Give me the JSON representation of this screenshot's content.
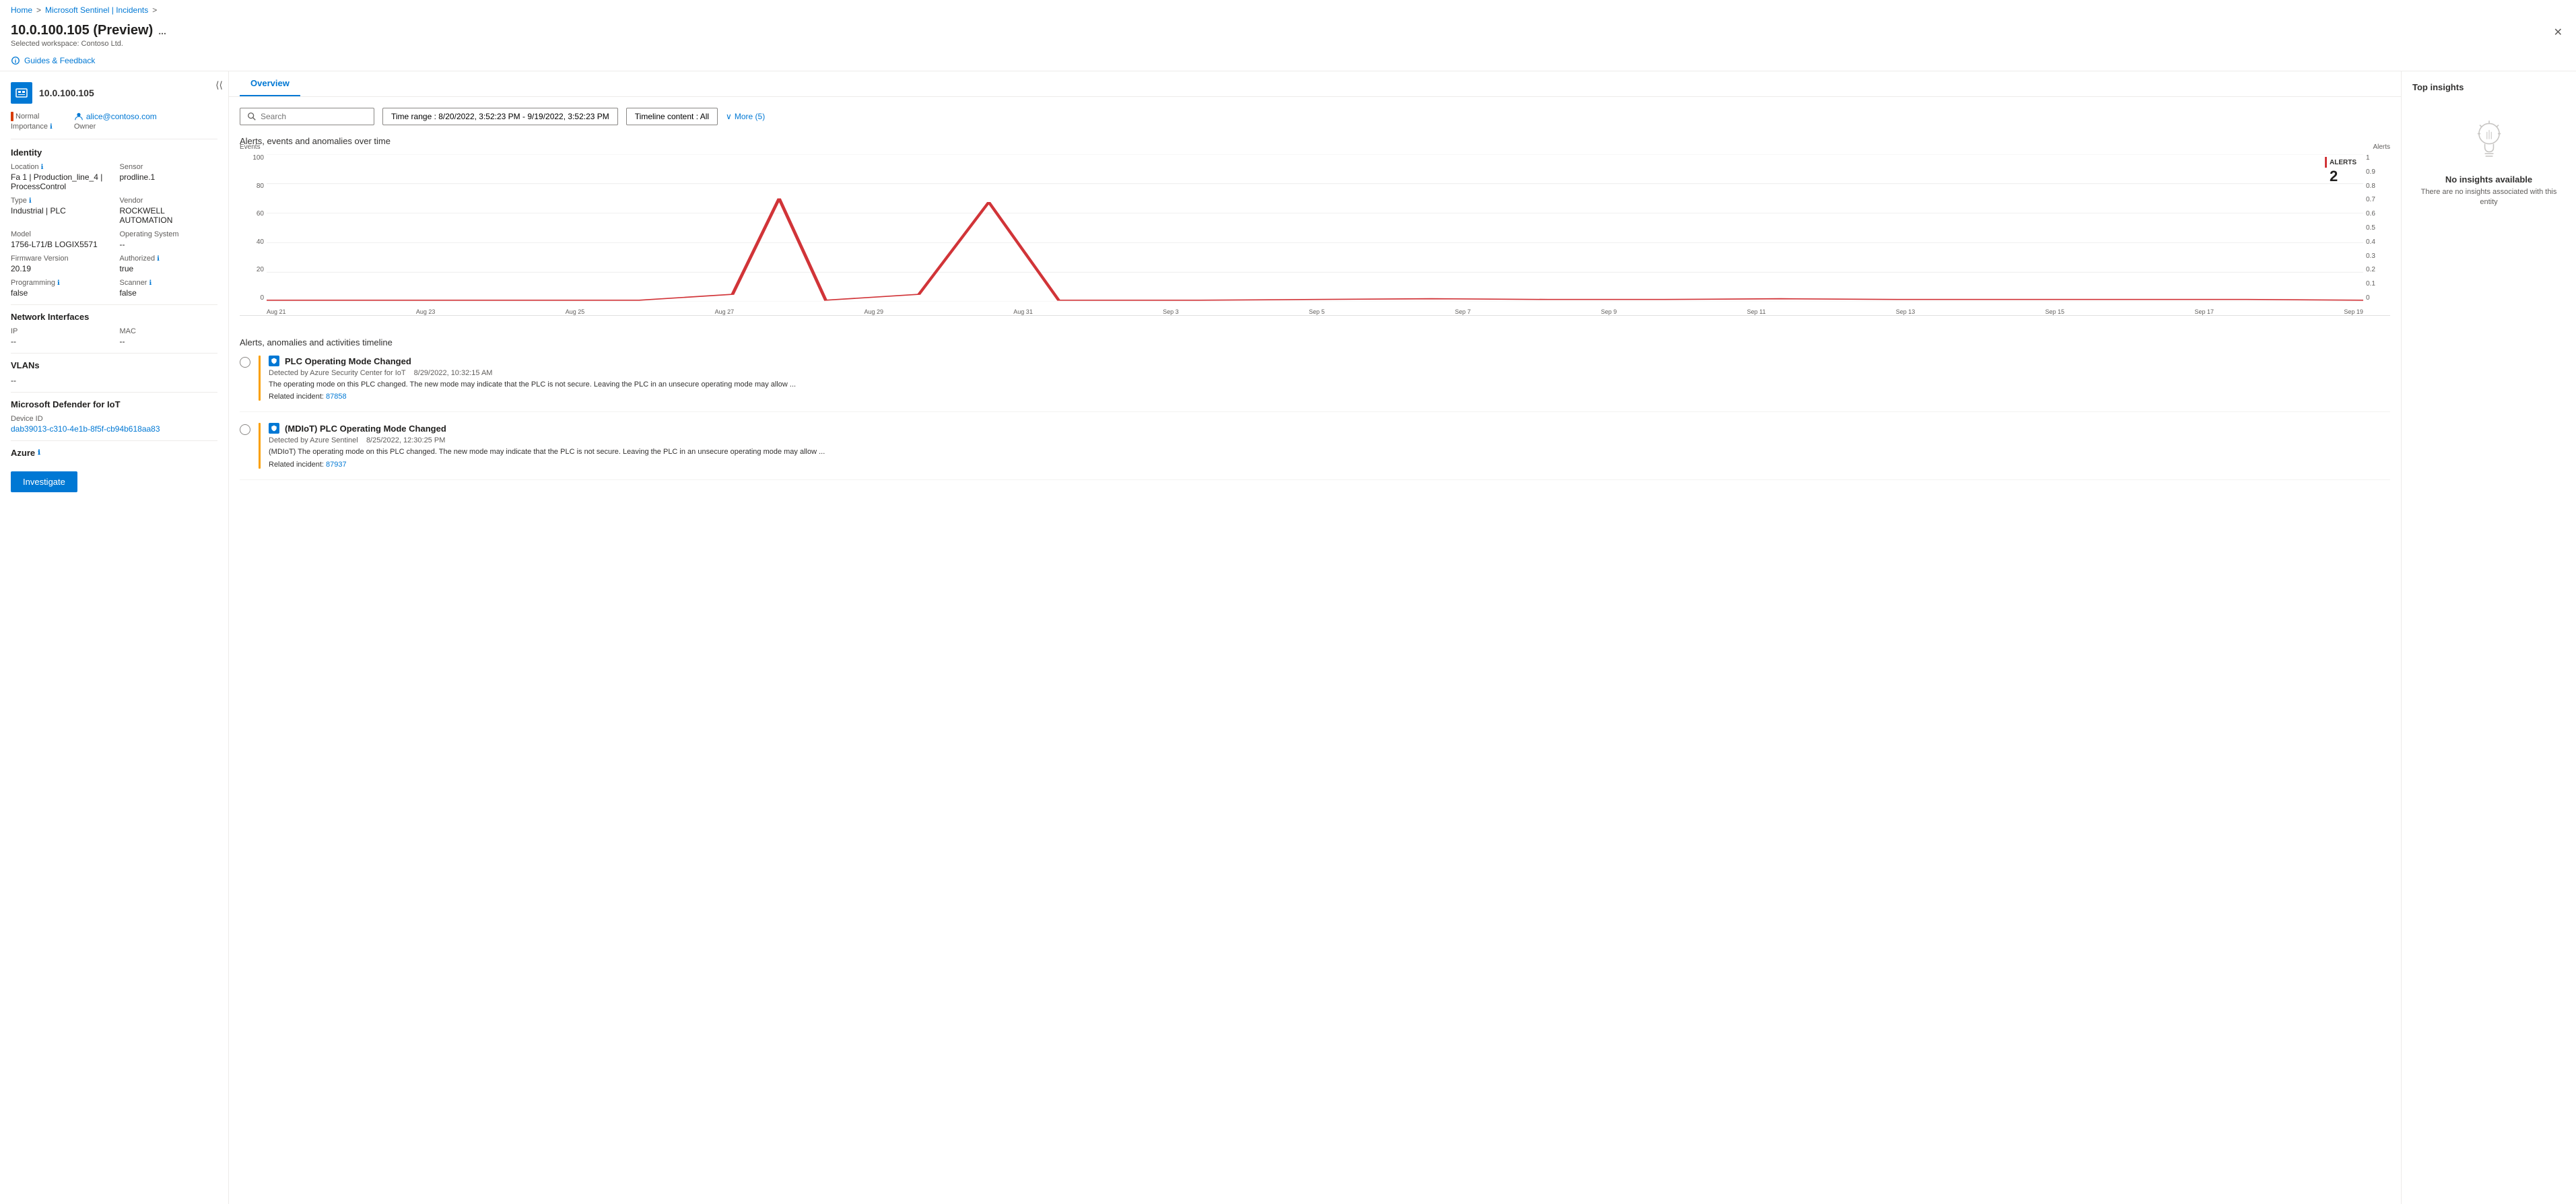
{
  "breadcrumb": {
    "home": "Home",
    "sentinel": "Microsoft Sentinel | Incidents",
    "separator": ">"
  },
  "header": {
    "title": "10.0.100.105 (Preview)",
    "subtitle": "Selected workspace: Contoso Ltd.",
    "more_label": "...",
    "close_label": "✕"
  },
  "guides": {
    "label": "Guides & Feedback"
  },
  "left_panel": {
    "entity_name": "10.0.100.105",
    "importance_label": "Importance",
    "importance_info": "ℹ",
    "status": "Normal",
    "owner_name": "alice@contoso.com",
    "owner_role": "Owner",
    "sections": {
      "identity": {
        "title": "Identity",
        "location_label": "Location",
        "location_info": "ℹ",
        "location_value": "Fa 1 | Production_line_4 | ProcessControl",
        "sensor_label": "Sensor",
        "sensor_value": "prodline.1",
        "type_label": "Type",
        "type_info": "ℹ",
        "type_value": "Industrial | PLC",
        "vendor_label": "Vendor",
        "vendor_value": "ROCKWELL AUTOMATION",
        "model_label": "Model",
        "model_value": "1756-L71/B LOGIX5571",
        "os_label": "Operating System",
        "os_value": "--",
        "firmware_label": "Firmware Version",
        "firmware_info": "",
        "firmware_value": "20.19",
        "authorized_label": "Authorized",
        "authorized_info": "ℹ",
        "authorized_value": "true",
        "programming_label": "Programming",
        "programming_info": "ℹ",
        "programming_value": "false",
        "scanner_label": "Scanner",
        "scanner_info": "ℹ",
        "scanner_value": "false"
      },
      "network": {
        "title": "Network Interfaces",
        "ip_label": "IP",
        "ip_value": "--",
        "mac_label": "MAC",
        "mac_value": "--"
      },
      "vlans": {
        "title": "VLANs",
        "value": "--"
      },
      "defender": {
        "title": "Microsoft Defender for IoT",
        "device_id_label": "Device ID",
        "device_id_value": "dab39013-c310-4e1b-8f5f-cb94b618aa83"
      },
      "azure": {
        "title": "Azure",
        "info": "ℹ"
      }
    },
    "investigate_btn": "Investigate"
  },
  "overview": {
    "tab_label": "Overview",
    "search_placeholder": "Search",
    "time_range_label": "Time range : 8/20/2022, 3:52:23 PM - 9/19/2022, 3:52:23 PM",
    "timeline_content_label": "Timeline content : All",
    "more_label": "More (5)",
    "chart": {
      "title": "Alerts, events and anomalies over time",
      "events_label": "Events",
      "alerts_label": "Alerts",
      "y_left": [
        "100",
        "80",
        "60",
        "40",
        "20",
        "0"
      ],
      "y_right": [
        "1",
        "0.9",
        "0.8",
        "0.7",
        "0.6",
        "0.5",
        "0.4",
        "0.3",
        "0.2",
        "0.1",
        "0"
      ],
      "x_labels": [
        "Aug 21",
        "Aug 23",
        "Aug 25",
        "Aug 27",
        "Aug 29",
        "Aug 31",
        "Sep 3",
        "Sep 5",
        "Sep 7",
        "Sep 9",
        "Sep 11",
        "Sep 13",
        "Sep 15",
        "Sep 17",
        "Sep 19"
      ],
      "alerts_count_label": "ALERTS",
      "alerts_count": "2"
    },
    "timeline": {
      "title": "Alerts, anomalies and activities timeline",
      "items": [
        {
          "title": "PLC Operating Mode Changed",
          "source": "Detected by Azure Security Center for IoT",
          "date": "8/29/2022, 10:32:15 AM",
          "description": "The operating mode on this PLC changed. The new mode may indicate that the PLC is not secure. Leaving the PLC in an unsecure operating mode may allow ...",
          "related_label": "Related incident:",
          "related_id": "87858",
          "related_link": "#87858"
        },
        {
          "title": "(MDIoT) PLC Operating Mode Changed",
          "source": "Detected by Azure Sentinel",
          "date": "8/25/2022, 12:30:25 PM",
          "description": "(MDIoT) The operating mode on this PLC changed. The new mode may indicate that the PLC is not secure. Leaving the PLC in an unsecure operating mode may allow ...",
          "related_label": "Related incident:",
          "related_id": "87937",
          "related_link": "#87937"
        }
      ]
    }
  },
  "insights": {
    "title": "Top insights",
    "no_insights_title": "No insights available",
    "no_insights_desc": "There are no insights associated with this entity"
  }
}
